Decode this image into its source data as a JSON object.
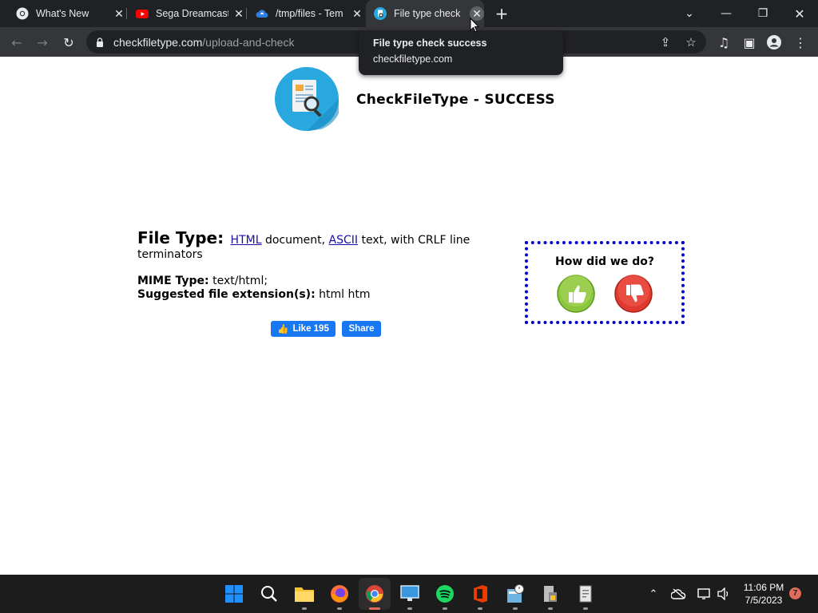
{
  "browser": {
    "tabs": [
      {
        "title": "What's New",
        "icon": "chrome-icon"
      },
      {
        "title": "Sega Dreamcast",
        "icon": "youtube-icon"
      },
      {
        "title": "/tmp/files - Tem",
        "icon": "cloud-icon"
      },
      {
        "title": "File type check",
        "icon": "checkfiletype-icon",
        "active": true
      }
    ],
    "address": {
      "host": "checkfiletype.com",
      "path": "/upload-and-check"
    },
    "tooltip": {
      "title": "File type check success",
      "domain": "checkfiletype.com"
    }
  },
  "page": {
    "site_title": "CheckFileType - SUCCESS",
    "file_type_label": "File Type:",
    "file_type_link1": "HTML",
    "file_type_text1": " document, ",
    "file_type_link2": "ASCII",
    "file_type_text2": " text, with CRLF line terminators",
    "mime_label": "MIME Type:",
    "mime_value": " text/html;",
    "ext_label": "Suggested file extension(s):",
    "ext_value": " html htm",
    "like_label": "Like 195",
    "share_label": "Share",
    "feedback_question": "How did we do?"
  },
  "taskbar": {
    "apps": [
      "windows-start",
      "search",
      "file-explorer",
      "firefox",
      "chrome",
      "remote-desktop",
      "spotify",
      "office",
      "calculator-clock",
      "notepad-server",
      "notepad"
    ],
    "clock_time": "11:06 PM",
    "clock_date": "7/5/2023",
    "notification_count": "7"
  },
  "colors": {
    "accent_facebook": "#1877f2",
    "feedback_border": "#0000cc",
    "thumb_up": "#7ab929",
    "thumb_down": "#d9342b"
  }
}
